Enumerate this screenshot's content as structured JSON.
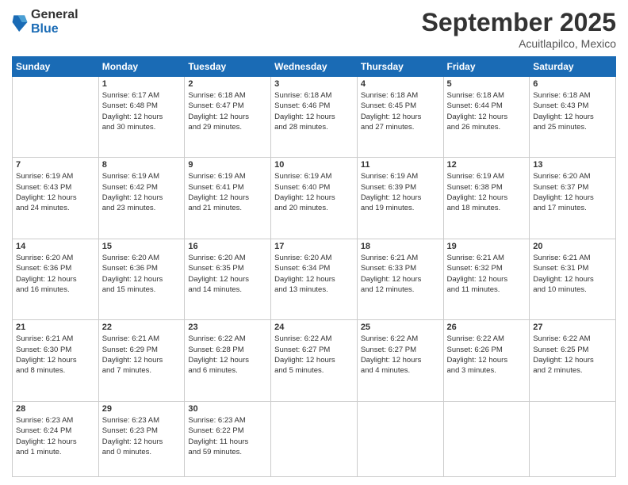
{
  "logo": {
    "general": "General",
    "blue": "Blue"
  },
  "title": "September 2025",
  "subtitle": "Acuitlapilco, Mexico",
  "days": [
    "Sunday",
    "Monday",
    "Tuesday",
    "Wednesday",
    "Thursday",
    "Friday",
    "Saturday"
  ],
  "weeks": [
    [
      {
        "day": "",
        "content": ""
      },
      {
        "day": "1",
        "content": "Sunrise: 6:17 AM\nSunset: 6:48 PM\nDaylight: 12 hours\nand 30 minutes."
      },
      {
        "day": "2",
        "content": "Sunrise: 6:18 AM\nSunset: 6:47 PM\nDaylight: 12 hours\nand 29 minutes."
      },
      {
        "day": "3",
        "content": "Sunrise: 6:18 AM\nSunset: 6:46 PM\nDaylight: 12 hours\nand 28 minutes."
      },
      {
        "day": "4",
        "content": "Sunrise: 6:18 AM\nSunset: 6:45 PM\nDaylight: 12 hours\nand 27 minutes."
      },
      {
        "day": "5",
        "content": "Sunrise: 6:18 AM\nSunset: 6:44 PM\nDaylight: 12 hours\nand 26 minutes."
      },
      {
        "day": "6",
        "content": "Sunrise: 6:18 AM\nSunset: 6:43 PM\nDaylight: 12 hours\nand 25 minutes."
      }
    ],
    [
      {
        "day": "7",
        "content": "Sunrise: 6:19 AM\nSunset: 6:43 PM\nDaylight: 12 hours\nand 24 minutes."
      },
      {
        "day": "8",
        "content": "Sunrise: 6:19 AM\nSunset: 6:42 PM\nDaylight: 12 hours\nand 23 minutes."
      },
      {
        "day": "9",
        "content": "Sunrise: 6:19 AM\nSunset: 6:41 PM\nDaylight: 12 hours\nand 21 minutes."
      },
      {
        "day": "10",
        "content": "Sunrise: 6:19 AM\nSunset: 6:40 PM\nDaylight: 12 hours\nand 20 minutes."
      },
      {
        "day": "11",
        "content": "Sunrise: 6:19 AM\nSunset: 6:39 PM\nDaylight: 12 hours\nand 19 minutes."
      },
      {
        "day": "12",
        "content": "Sunrise: 6:19 AM\nSunset: 6:38 PM\nDaylight: 12 hours\nand 18 minutes."
      },
      {
        "day": "13",
        "content": "Sunrise: 6:20 AM\nSunset: 6:37 PM\nDaylight: 12 hours\nand 17 minutes."
      }
    ],
    [
      {
        "day": "14",
        "content": "Sunrise: 6:20 AM\nSunset: 6:36 PM\nDaylight: 12 hours\nand 16 minutes."
      },
      {
        "day": "15",
        "content": "Sunrise: 6:20 AM\nSunset: 6:36 PM\nDaylight: 12 hours\nand 15 minutes."
      },
      {
        "day": "16",
        "content": "Sunrise: 6:20 AM\nSunset: 6:35 PM\nDaylight: 12 hours\nand 14 minutes."
      },
      {
        "day": "17",
        "content": "Sunrise: 6:20 AM\nSunset: 6:34 PM\nDaylight: 12 hours\nand 13 minutes."
      },
      {
        "day": "18",
        "content": "Sunrise: 6:21 AM\nSunset: 6:33 PM\nDaylight: 12 hours\nand 12 minutes."
      },
      {
        "day": "19",
        "content": "Sunrise: 6:21 AM\nSunset: 6:32 PM\nDaylight: 12 hours\nand 11 minutes."
      },
      {
        "day": "20",
        "content": "Sunrise: 6:21 AM\nSunset: 6:31 PM\nDaylight: 12 hours\nand 10 minutes."
      }
    ],
    [
      {
        "day": "21",
        "content": "Sunrise: 6:21 AM\nSunset: 6:30 PM\nDaylight: 12 hours\nand 8 minutes."
      },
      {
        "day": "22",
        "content": "Sunrise: 6:21 AM\nSunset: 6:29 PM\nDaylight: 12 hours\nand 7 minutes."
      },
      {
        "day": "23",
        "content": "Sunrise: 6:22 AM\nSunset: 6:28 PM\nDaylight: 12 hours\nand 6 minutes."
      },
      {
        "day": "24",
        "content": "Sunrise: 6:22 AM\nSunset: 6:27 PM\nDaylight: 12 hours\nand 5 minutes."
      },
      {
        "day": "25",
        "content": "Sunrise: 6:22 AM\nSunset: 6:27 PM\nDaylight: 12 hours\nand 4 minutes."
      },
      {
        "day": "26",
        "content": "Sunrise: 6:22 AM\nSunset: 6:26 PM\nDaylight: 12 hours\nand 3 minutes."
      },
      {
        "day": "27",
        "content": "Sunrise: 6:22 AM\nSunset: 6:25 PM\nDaylight: 12 hours\nand 2 minutes."
      }
    ],
    [
      {
        "day": "28",
        "content": "Sunrise: 6:23 AM\nSunset: 6:24 PM\nDaylight: 12 hours\nand 1 minute."
      },
      {
        "day": "29",
        "content": "Sunrise: 6:23 AM\nSunset: 6:23 PM\nDaylight: 12 hours\nand 0 minutes."
      },
      {
        "day": "30",
        "content": "Sunrise: 6:23 AM\nSunset: 6:22 PM\nDaylight: 11 hours\nand 59 minutes."
      },
      {
        "day": "",
        "content": ""
      },
      {
        "day": "",
        "content": ""
      },
      {
        "day": "",
        "content": ""
      },
      {
        "day": "",
        "content": ""
      }
    ]
  ]
}
